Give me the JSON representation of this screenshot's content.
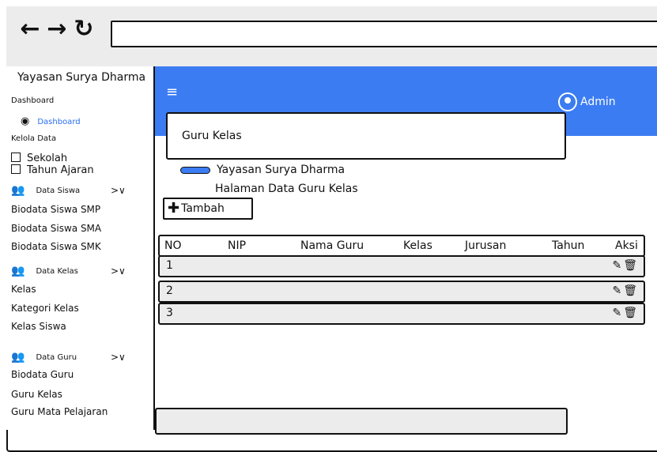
{
  "browser": {
    "back_icon": "←",
    "forward_icon": "→",
    "reload_icon": "↻",
    "url": ""
  },
  "sidebar": {
    "brand": "Yayasan Surya Dharma",
    "dashboard_section": "Dashboard",
    "dashboard_link": "Dashboard",
    "kelola_section": "Kelola Data",
    "checks": [
      "Sekolah",
      "Tahun Ajaran"
    ],
    "group_siswa": "Data Siswa",
    "siswa_items": [
      "Biodata Siswa SMP",
      "Biodata Siswa SMA",
      "Biodata Siswa SMK"
    ],
    "group_kelas": "Data Kelas",
    "kelas_items": [
      "Kelas",
      "Kategori Kelas",
      "Kelas Siswa"
    ],
    "group_guru": "Data Guru",
    "guru_items": [
      "Biodata Guru",
      "Guru Kelas",
      "Guru Mata Pelajaran"
    ],
    "chevron": ">∨",
    "users_icon": "👥"
  },
  "header": {
    "menu_icon": "≡",
    "admin": "Admin"
  },
  "page": {
    "title": "Guru Kelas",
    "breadcrumb_home": "Yayasan Surya Dharma",
    "breadcrumb_page": "Halaman Data Guru Kelas",
    "add_label": "Tambah"
  },
  "table": {
    "headers": [
      "NO",
      "NIP",
      "Nama Guru",
      "Kelas",
      "Jurusan",
      "Tahun",
      "Aksi"
    ],
    "rows": [
      {
        "no": "1"
      },
      {
        "no": "2"
      },
      {
        "no": "3"
      }
    ],
    "edit_icon": "✎",
    "delete_icon": "🗑"
  },
  "colors": {
    "accent": "#3b7cf2",
    "link": "#2a6df4"
  }
}
